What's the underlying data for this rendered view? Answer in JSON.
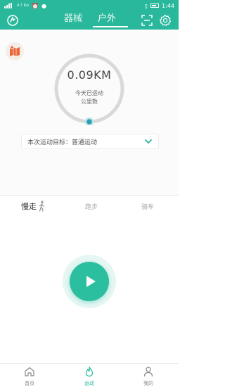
{
  "status_bar": {
    "network": "4.7\nK/s",
    "time": "1:44"
  },
  "header": {
    "tabs": [
      {
        "label": "器械",
        "active": false
      },
      {
        "label": "户外",
        "active": true
      }
    ]
  },
  "stats": {
    "distance": "0.09KM",
    "label_line1": "今天已运动",
    "label_line2": "公里数"
  },
  "goal": {
    "text": "本次运动目标：普通运动"
  },
  "modes": [
    {
      "label": "慢走",
      "active": true
    },
    {
      "label": "跑步",
      "active": false
    },
    {
      "label": "骑车",
      "active": false
    }
  ],
  "bottom_nav": [
    {
      "label": "首页",
      "active": false,
      "icon": "home-icon"
    },
    {
      "label": "运动",
      "active": true,
      "icon": "flame-icon"
    },
    {
      "label": "我的",
      "active": false,
      "icon": "user-icon"
    }
  ],
  "colors": {
    "primary": "#29b89c",
    "button": "#2cbf9f"
  }
}
